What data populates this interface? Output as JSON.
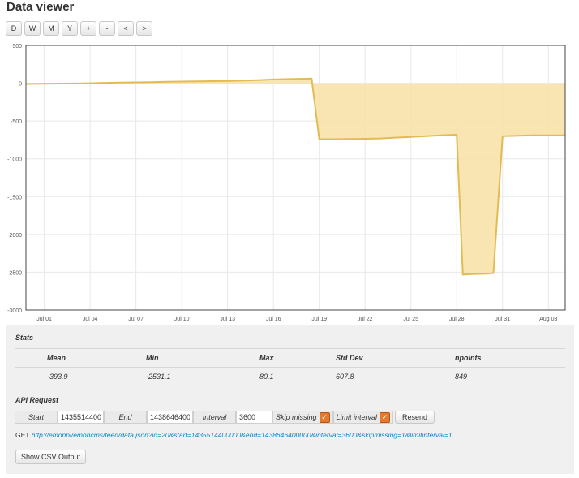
{
  "page": {
    "title": "Data viewer"
  },
  "toolbar": {
    "buttons": [
      "D",
      "W",
      "M",
      "Y",
      "+",
      "-",
      "<",
      ">"
    ]
  },
  "chart_data": {
    "type": "area",
    "title": "",
    "xlabel": "",
    "ylabel": "",
    "ylim": [
      -3000,
      500
    ],
    "y_ticks": [
      "500",
      "0",
      "-500",
      "-1000",
      "-1500",
      "-2000",
      "-2500",
      "-3000"
    ],
    "y_tick_values": [
      500,
      0,
      -500,
      -1000,
      -1500,
      -2000,
      -2500,
      -3000
    ],
    "x_ticks": [
      "Jul 01",
      "Jul 04",
      "Jul 07",
      "Jul 10",
      "Jul 13",
      "Jul 16",
      "Jul 19",
      "Jul 22",
      "Jul 25",
      "Jul 28",
      "Jul 31",
      "Aug 03"
    ],
    "x_tick_days": [
      1,
      4,
      7,
      10,
      13,
      16,
      19,
      22,
      25,
      28,
      31,
      34
    ],
    "xlim_days": [
      -0.2,
      35.1
    ],
    "grid": true,
    "color": "#e3bb52",
    "fill_color": "#f7e2a8",
    "series": [
      {
        "x_days": [
          -0.2,
          1,
          2,
          3,
          4,
          5,
          6,
          7,
          8,
          9,
          10,
          11,
          12,
          13,
          14,
          15,
          16,
          17,
          18.2,
          18.5,
          19,
          20,
          21,
          22,
          23,
          24,
          25,
          26,
          27,
          28,
          28.4,
          29,
          30,
          30.4,
          31,
          32,
          33,
          34,
          35.1
        ],
        "y": [
          -10,
          -8,
          -5,
          -3,
          0,
          5,
          8,
          12,
          15,
          20,
          22,
          25,
          28,
          30,
          35,
          42,
          50,
          55,
          60,
          62,
          -740,
          -740,
          -738,
          -735,
          -730,
          -720,
          -710,
          -700,
          -690,
          -680,
          -2531,
          -2525,
          -2520,
          -2510,
          -700,
          -695,
          -690,
          -688,
          -690
        ]
      }
    ]
  },
  "stats": {
    "title": "Stats",
    "headers": [
      "Mean",
      "Min",
      "Max",
      "Std Dev",
      "npoints"
    ],
    "values": [
      "-393.9",
      "-2531.1",
      "80.1",
      "607.8",
      "849"
    ]
  },
  "api": {
    "title": "API Request",
    "start_label": "Start",
    "start_value": "1435514400000",
    "end_label": "End",
    "end_value": "1438646400000",
    "interval_label": "Interval",
    "interval_value": "3600",
    "skip_missing_label": "Skip missing",
    "limit_interval_label": "Limit interval",
    "resend_label": "Resend",
    "get_prefix": "GET",
    "get_url": "http://emonpi/emoncms/feed/data.json?id=20&start=1435514400000&end=1438646400000&interval=3600&skipmissing=1&limitinterval=1",
    "csv_button_label": "Show CSV Output"
  }
}
